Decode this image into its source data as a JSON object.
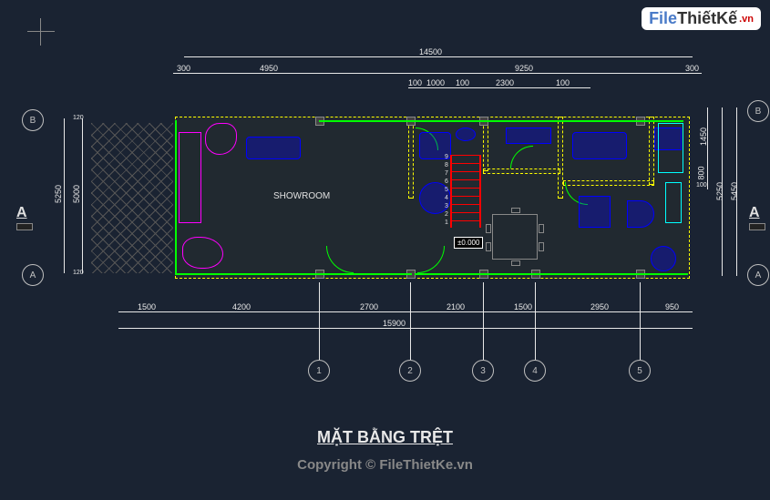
{
  "logo": {
    "part1": "File",
    "part2": "ThiếtKế",
    "suffix": ".vn"
  },
  "title": "MẶT BẰNG TRỆT",
  "copyright": "Copyright © FileThietKe.vn",
  "dimensions": {
    "top_total": "14500",
    "top_left": "4950",
    "top_left_ext": "300",
    "top_right": "9250",
    "top_right_ext": "300",
    "top_r1": "100",
    "top_r2": "1000",
    "top_r3": "100",
    "top_r4": "2300",
    "top_r5": "100",
    "bottom_total": "15900",
    "bottom_1": "1500",
    "bottom_2": "4200",
    "bottom_3": "2700",
    "bottom_4": "2100",
    "bottom_5": "1500",
    "bottom_6": "2950",
    "bottom_7": "950",
    "left_total": "5250",
    "left_inner": "5000",
    "left_t": "120",
    "left_b": "120",
    "right_total": "5450",
    "right_inner": "5250",
    "right_1": "1450",
    "right_2": "800",
    "right_3": "100"
  },
  "rooms": {
    "showroom": "SHOWROOM"
  },
  "level": "±0.000",
  "section_marks": {
    "left": "A",
    "right": "A"
  },
  "grid_labels": {
    "g1": "1",
    "g2": "2",
    "g3": "3",
    "g4": "4",
    "g5": "5",
    "gA": "A",
    "gB": "B"
  },
  "stair_numbers": [
    "9",
    "8",
    "7",
    "6",
    "5",
    "4",
    "3",
    "2",
    "1"
  ],
  "colors": {
    "bg": "#1a2332",
    "dim": "#e8e8e8",
    "wall": "#ffff00",
    "door": "#00ff00",
    "furniture": "#0000ff",
    "stair": "#ff0000",
    "magenta": "#ff00ff",
    "cyan": "#00ffff"
  }
}
